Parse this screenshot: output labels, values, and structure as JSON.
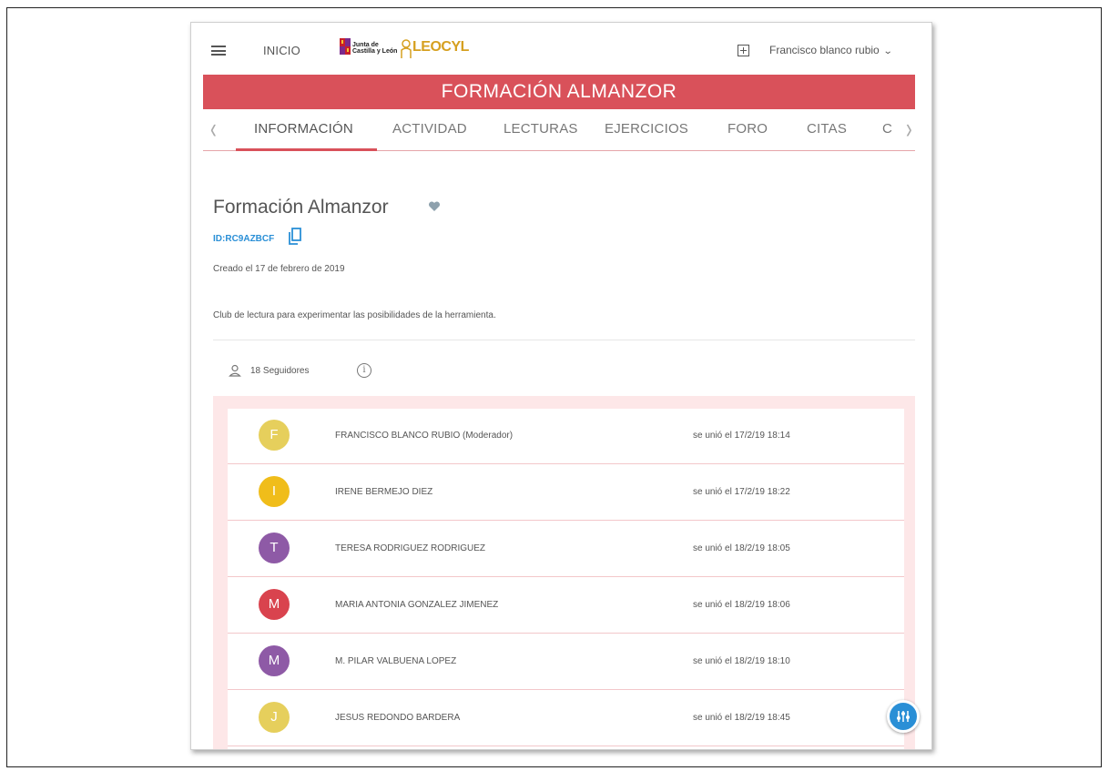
{
  "header": {
    "menu_icon": "hamburger-icon",
    "home_label": "INICIO",
    "logo_junta_line1": "Junta de",
    "logo_junta_line2": "Castilla y León",
    "logo_leo": "LEOCYL",
    "add_icon": "plus-square-icon",
    "user_name": "Francisco blanco rubio",
    "user_chevron": "⌄"
  },
  "banner": {
    "title": "FORMACIÓN ALMANZOR",
    "color": "#d9515a"
  },
  "tabs": {
    "prev_arrow": "‹",
    "next_arrow": "›",
    "items": [
      {
        "label": "INFORMACIÓN",
        "active": true
      },
      {
        "label": "ACTIVIDAD"
      },
      {
        "label": "LECTURAS"
      },
      {
        "label": "EJERCICIOS"
      },
      {
        "label": "FORO"
      },
      {
        "label": "CITAS"
      },
      {
        "label": "C"
      }
    ]
  },
  "group": {
    "title": "Formación Almanzor",
    "id_label": "ID:",
    "id_value": "RC9AZBCF",
    "created": "Creado el 17 de febrero de 2019",
    "description": "Club de lectura para experimentar las posibilidades de la herramienta.",
    "followers": "18 Seguidores",
    "info_glyph": "i"
  },
  "members": [
    {
      "initial": "F",
      "name": "FRANCISCO BLANCO RUBIO (Moderador)",
      "joined": "se unió el 17/2/19 18:14",
      "color": "#e6cf5c"
    },
    {
      "initial": "I",
      "name": "IRENE BERMEJO DIEZ",
      "joined": "se unió el 17/2/19 18:22",
      "color": "#f0bd1a"
    },
    {
      "initial": "T",
      "name": "TERESA RODRIGUEZ RODRIGUEZ",
      "joined": "se unió el 18/2/19 18:05",
      "color": "#8e5aa6"
    },
    {
      "initial": "M",
      "name": "MARIA ANTONIA GONZALEZ JIMENEZ",
      "joined": "se unió el 18/2/19 18:06",
      "color": "#d9434e"
    },
    {
      "initial": "M",
      "name": "M. PILAR VALBUENA LOPEZ",
      "joined": "se unió el 18/2/19 18:10",
      "color": "#8e5aa6"
    },
    {
      "initial": "J",
      "name": "JESUS REDONDO BARDERA",
      "joined": "se unió el 18/2/19 18:45",
      "color": "#e6cf5c"
    }
  ],
  "fab_icon": "accessibility-settings-icon"
}
